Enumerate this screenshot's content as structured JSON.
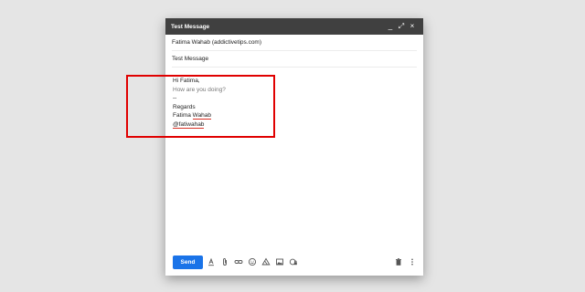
{
  "window": {
    "title": "Test Message",
    "minimize_label": "_",
    "expand_label": "⤢",
    "close_label": "×"
  },
  "fields": {
    "recipient": "Fatima Wahab (addictivetips.com)",
    "subject": "Test Message"
  },
  "message": {
    "greeting": "Hi Fatima,",
    "question": "How are you doing?",
    "signature_separator": "--",
    "regards": "Regards",
    "name_first": "Fatima ",
    "name_last": "Wahab",
    "handle": "@fatiwahab"
  },
  "toolbar": {
    "send_label": "Send",
    "icons": [
      "format-text-icon",
      "attach-icon",
      "link-icon",
      "emoji-icon",
      "drive-icon",
      "photo-icon",
      "confidential-icon"
    ]
  },
  "colors": {
    "title_bar": "#404040",
    "send_button": "#1a73e8",
    "highlight_box": "#e00000"
  }
}
